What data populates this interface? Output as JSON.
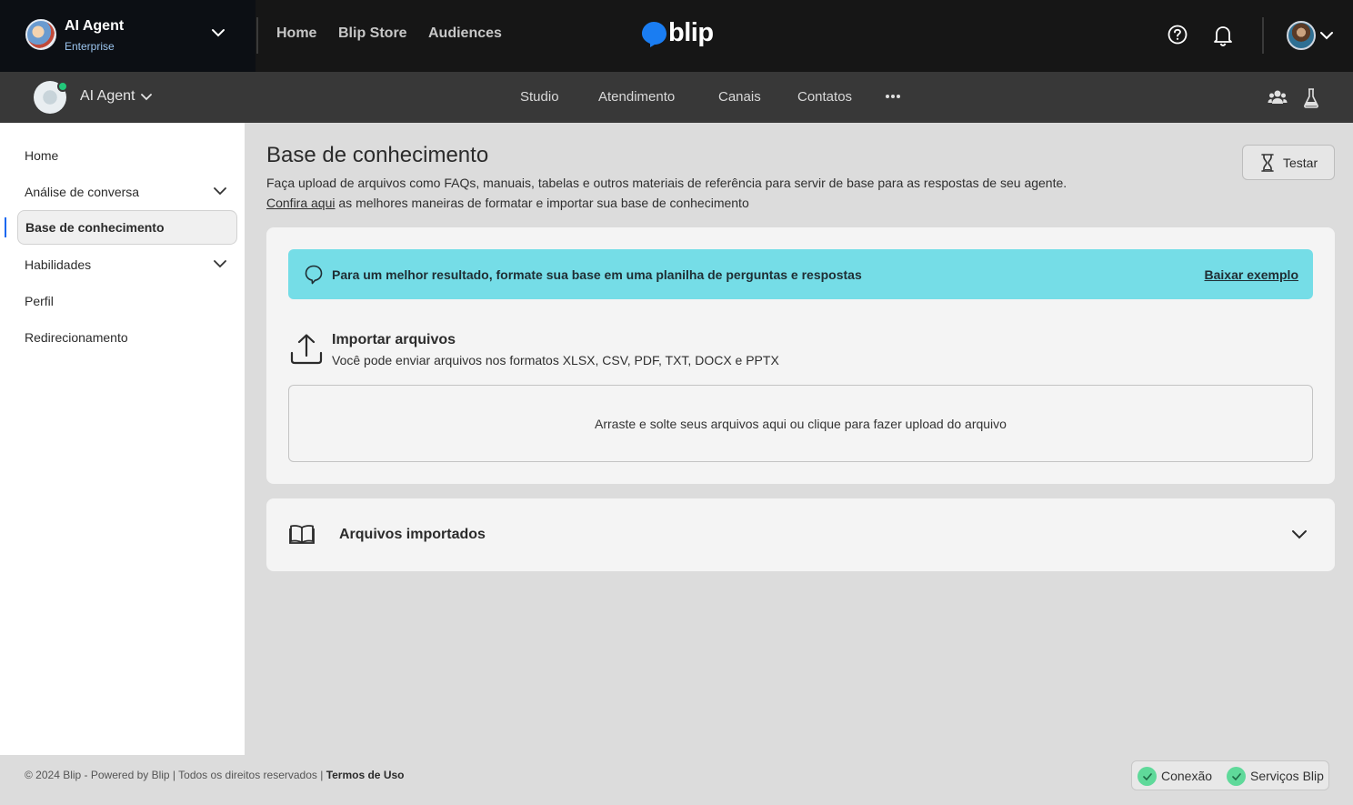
{
  "topbar": {
    "org_name": "AI Agent",
    "org_plan": "Enterprise",
    "nav": [
      "Home",
      "Blip Store",
      "Audiences"
    ],
    "logo_text": "blip"
  },
  "subbar": {
    "bot_name": "AI Agent",
    "nav": [
      "Studio",
      "Atendimento",
      "Canais",
      "Contatos"
    ]
  },
  "sidebar": {
    "items": [
      {
        "label": "Home",
        "expandable": false,
        "active": false
      },
      {
        "label": "Análise de conversa",
        "expandable": true,
        "active": false
      },
      {
        "label": "Base de conhecimento",
        "expandable": false,
        "active": true
      },
      {
        "label": "Habilidades",
        "expandable": true,
        "active": false
      },
      {
        "label": "Perfil",
        "expandable": false,
        "active": false
      },
      {
        "label": "Redirecionamento",
        "expandable": false,
        "active": false
      }
    ]
  },
  "main": {
    "title": "Base de conhecimento",
    "description": "Faça upload de arquivos como FAQs, manuais, tabelas e outros materiais de referência para servir de base para as respostas de seu agente.",
    "link_text": "Confira aqui",
    "link_suffix": " as melhores maneiras de formatar e importar sua base de conhecimento",
    "test_button": "Testar",
    "tip_text": "Para um melhor resultado, formate sua base em uma planilha de perguntas e respostas",
    "tip_link": "Baixar exemplo",
    "import_title": "Importar arquivos",
    "import_subtitle": "Você pode enviar arquivos nos formatos XLSX, CSV, PDF, TXT, DOCX e PPTX",
    "dropzone_text": "Arraste e solte seus arquivos aqui ou clique para fazer upload do arquivo",
    "imported_title": "Arquivos importados"
  },
  "footer": {
    "copyright": "© 2024 Blip - Powered by Blip | Todos os direitos reservados | ",
    "terms": "Termos de Uso",
    "status": [
      "Conexão",
      "Serviços Blip"
    ]
  },
  "colors": {
    "topbar": "#161616",
    "subbar": "#383838",
    "tip": "#75dde7",
    "accent": "#1968f0",
    "status_ok": "#5fd99a"
  }
}
